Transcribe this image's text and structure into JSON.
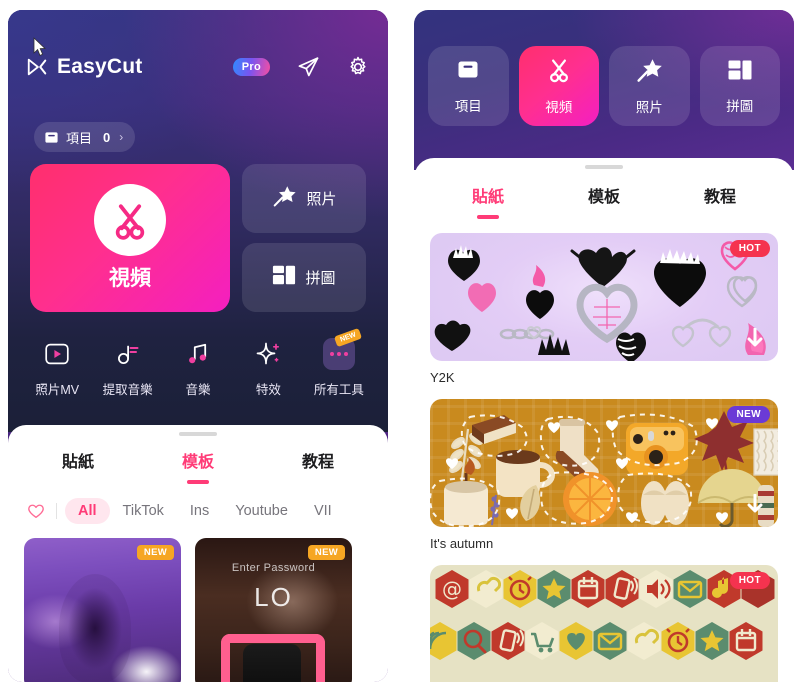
{
  "app": {
    "name": "EasyCut",
    "pro_badge": "Pro",
    "logo_icon": "easycut-logo-icon",
    "send_icon": "send-plane-icon",
    "settings_icon": "gear-icon"
  },
  "left": {
    "project_pill": {
      "icon": "folder-icon",
      "label": "項目",
      "count": "0",
      "chevron": "›"
    },
    "hero": {
      "video": {
        "label": "視頻",
        "icon": "scissors-icon"
      },
      "photo": {
        "label": "照片",
        "icon": "magic-wand-star-icon"
      },
      "collage": {
        "label": "拼圖",
        "icon": "collage-grid-icon"
      }
    },
    "tools": [
      {
        "label": "照片MV",
        "icon": "play-frame-icon",
        "tag": ""
      },
      {
        "label": "提取音樂",
        "icon": "music-extract-icon",
        "tag": ""
      },
      {
        "label": "音樂",
        "icon": "music-note-icon",
        "tag": ""
      },
      {
        "label": "特效",
        "icon": "sparkle-icon",
        "tag": ""
      },
      {
        "label": "所有工具",
        "icon": "more-dots-icon",
        "tag": "NEW"
      }
    ],
    "tabs": [
      {
        "label": "貼紙",
        "active": false
      },
      {
        "label": "模板",
        "active": true
      },
      {
        "label": "教程",
        "active": false
      }
    ],
    "filters": {
      "heart_icon": "heart-outline-icon",
      "chips": [
        {
          "label": "All",
          "active": true
        },
        {
          "label": "TikTok",
          "active": false
        },
        {
          "label": "Ins",
          "active": false
        },
        {
          "label": "Youtube",
          "active": false
        },
        {
          "label": "VII",
          "active": false
        }
      ]
    },
    "templates": [
      {
        "badge": "NEW",
        "overlay_title": "",
        "overlay_sub": ""
      },
      {
        "badge": "NEW",
        "overlay_title": "LO",
        "overlay_sub": "Enter Password"
      }
    ]
  },
  "right": {
    "nav": [
      {
        "label": "項目",
        "icon": "folder-icon",
        "active": false
      },
      {
        "label": "視頻",
        "icon": "scissors-icon",
        "active": true
      },
      {
        "label": "照片",
        "icon": "magic-wand-star-icon",
        "active": false
      },
      {
        "label": "拼圖",
        "icon": "collage-grid-icon",
        "active": false
      }
    ],
    "tabs": [
      {
        "label": "貼紙",
        "active": true
      },
      {
        "label": "模板",
        "active": false
      },
      {
        "label": "教程",
        "active": false
      }
    ],
    "packs": [
      {
        "name": "Y2K",
        "badge": "HOT",
        "badge_type": "hot"
      },
      {
        "name": "It's autumn",
        "badge": "NEW",
        "badge_type": "new"
      },
      {
        "name": "",
        "badge": "HOT",
        "badge_type": "hot"
      }
    ]
  },
  "colors": {
    "accent_pink": "#ff3b77",
    "hero_pink": "#ff2f8e",
    "badge_orange": "#f6a623",
    "badge_purple": "#6b3ad6",
    "badge_red": "#f5334f",
    "panel_purple": "#4a2580"
  }
}
